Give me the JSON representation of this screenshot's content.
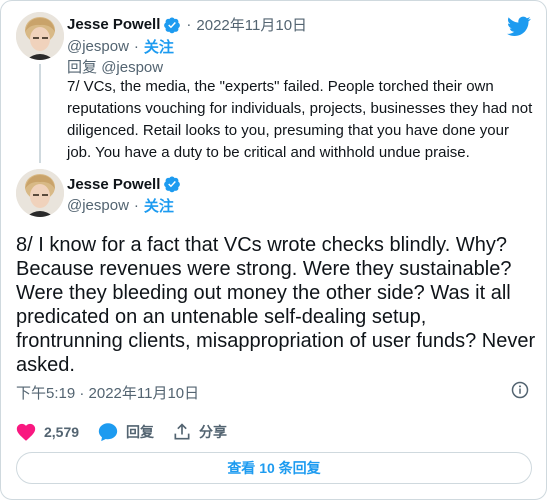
{
  "quoted": {
    "author_name": "Jesse Powell",
    "handle": "@jespow",
    "date": "2022年11月10日",
    "follow_label": "关注",
    "reply_label": "回复",
    "reply_to_handle": "@jespow",
    "text": "7/ VCs, the media, the \"experts\" failed. People torched their own reputations vouching for individuals, projects, businesses they had not diligenced. Retail looks to you, presuming that you have done your job. You have a duty to be critical and withhold undue praise."
  },
  "main": {
    "author_name": "Jesse Powell",
    "handle": "@jespow",
    "follow_label": "关注",
    "text": "8/ I know for a fact that VCs wrote checks blindly. Why? Because revenues were strong. Were they sustainable? Were they bleeding out money the other side? Was it all predicated on an untenable self-dealing setup, frontrunning clients, misappropriation of user funds? Never asked.",
    "timestamp": "下午5:19 · 2022年11月10日"
  },
  "actions": {
    "like_count": "2,579",
    "reply_label": "回复",
    "share_label": "分享"
  },
  "replies_button": "查看 10 条回复",
  "colors": {
    "accent": "#1d9bf0",
    "like": "#f91880",
    "text": "#0f1419",
    "muted": "#536471",
    "border": "#cfd9de"
  },
  "icons": [
    "twitter-bird-icon",
    "verified-badge-icon",
    "info-icon",
    "heart-icon",
    "reply-bubble-icon",
    "share-icon"
  ]
}
